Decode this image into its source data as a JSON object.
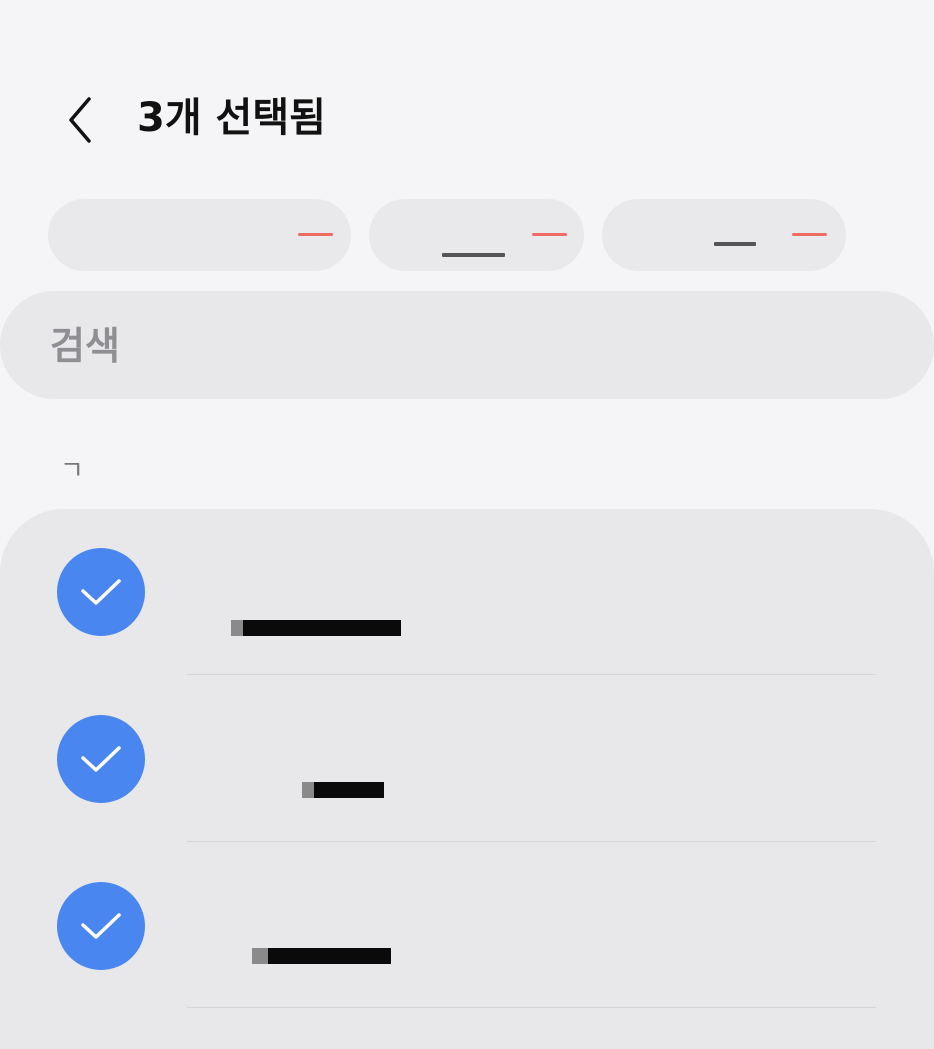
{
  "header": {
    "title": "3개 선택됨"
  },
  "chips": [
    {
      "remove_color": "#ee6c63"
    },
    {
      "remove_color": "#ee6c63"
    },
    {
      "remove_color": "#ee6c63"
    }
  ],
  "search": {
    "placeholder": "검색"
  },
  "section": {
    "index": "ㄱ"
  },
  "contacts": [
    {
      "selected": true
    },
    {
      "selected": true
    },
    {
      "selected": true
    }
  ],
  "colors": {
    "accent": "#4a86f0",
    "remove": "#ee6c63",
    "background": "#f5f5f7",
    "panel": "#e8e8ea"
  }
}
